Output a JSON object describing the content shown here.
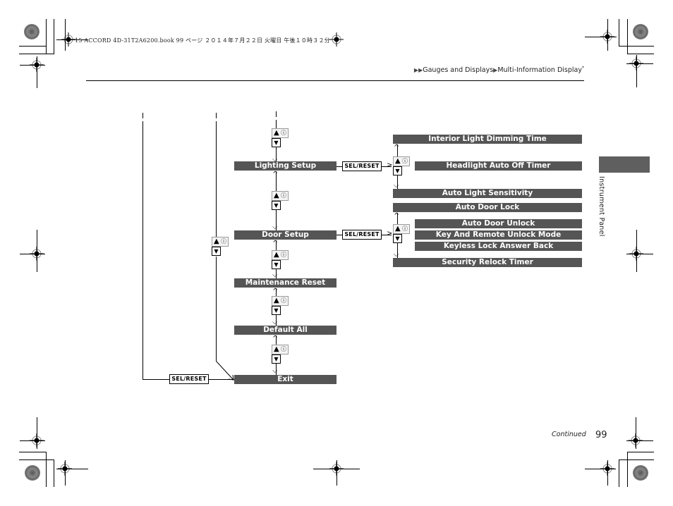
{
  "print_header": "15 ACCORD 4D-31T2A6200.book  99 ページ  ２０１４年７月２２日  火曜日  午後１０時３２分",
  "breadcrumb": {
    "marker": "▶▶",
    "items": [
      "Gauges and Displays",
      "Multi-Information Display"
    ],
    "separator": "▶",
    "footnote_mark": "*"
  },
  "side_tab": {
    "label": "Instrument Panel",
    "color": "#5f5f5f"
  },
  "diagram": {
    "bar_color": "#555555",
    "main_menu": [
      {
        "label": "Lighting Setup"
      },
      {
        "label": "Door Setup"
      },
      {
        "label": "Maintenance Reset"
      },
      {
        "label": "Default All"
      },
      {
        "label": "Exit"
      }
    ],
    "sel_reset_label": "SEL/RESET",
    "updown_icon": {
      "up": "▲",
      "info": "ⓘ",
      "down": "▼"
    },
    "lighting_submenu": [
      {
        "label": "Interior Light Dimming Time"
      },
      {
        "label": "Headlight Auto Off Timer"
      },
      {
        "label": "Auto Light Sensitivity"
      }
    ],
    "door_submenu": [
      {
        "label": "Auto Door Lock"
      },
      {
        "label": "Auto Door Unlock"
      },
      {
        "label": "Key And Remote Unlock Mode"
      },
      {
        "label": "Keyless Lock Answer Back"
      },
      {
        "label": "Security Relock Timer"
      }
    ]
  },
  "footer": {
    "continued": "Continued",
    "page_number": "99"
  }
}
